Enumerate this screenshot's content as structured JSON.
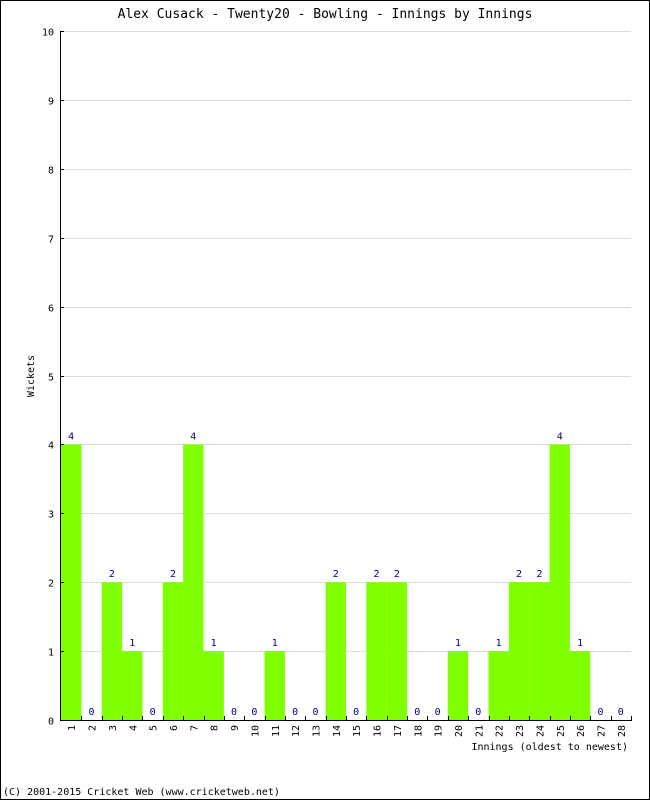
{
  "chart_data": {
    "type": "bar",
    "title": "Alex Cusack - Twenty20 - Bowling - Innings by Innings",
    "xlabel": "Innings (oldest to newest)",
    "ylabel": "Wickets",
    "ylim": [
      0,
      10
    ],
    "yticks": [
      0,
      1,
      2,
      3,
      4,
      5,
      6,
      7,
      8,
      9,
      10
    ],
    "grid": true,
    "categories": [
      "1",
      "2",
      "3",
      "4",
      "5",
      "6",
      "7",
      "8",
      "9",
      "10",
      "11",
      "12",
      "13",
      "14",
      "15",
      "16",
      "17",
      "18",
      "19",
      "20",
      "21",
      "22",
      "23",
      "24",
      "25",
      "26",
      "27",
      "28"
    ],
    "values": [
      4,
      0,
      2,
      1,
      0,
      2,
      4,
      1,
      0,
      0,
      1,
      0,
      0,
      2,
      0,
      2,
      2,
      0,
      0,
      1,
      0,
      1,
      2,
      2,
      4,
      1,
      0,
      0
    ],
    "colors": {
      "bar": "#80ff00",
      "label": "#000080",
      "grid": "#dddddd"
    }
  },
  "footer": {
    "copyright": "(C) 2001-2015 Cricket Web (www.cricketweb.net)"
  }
}
